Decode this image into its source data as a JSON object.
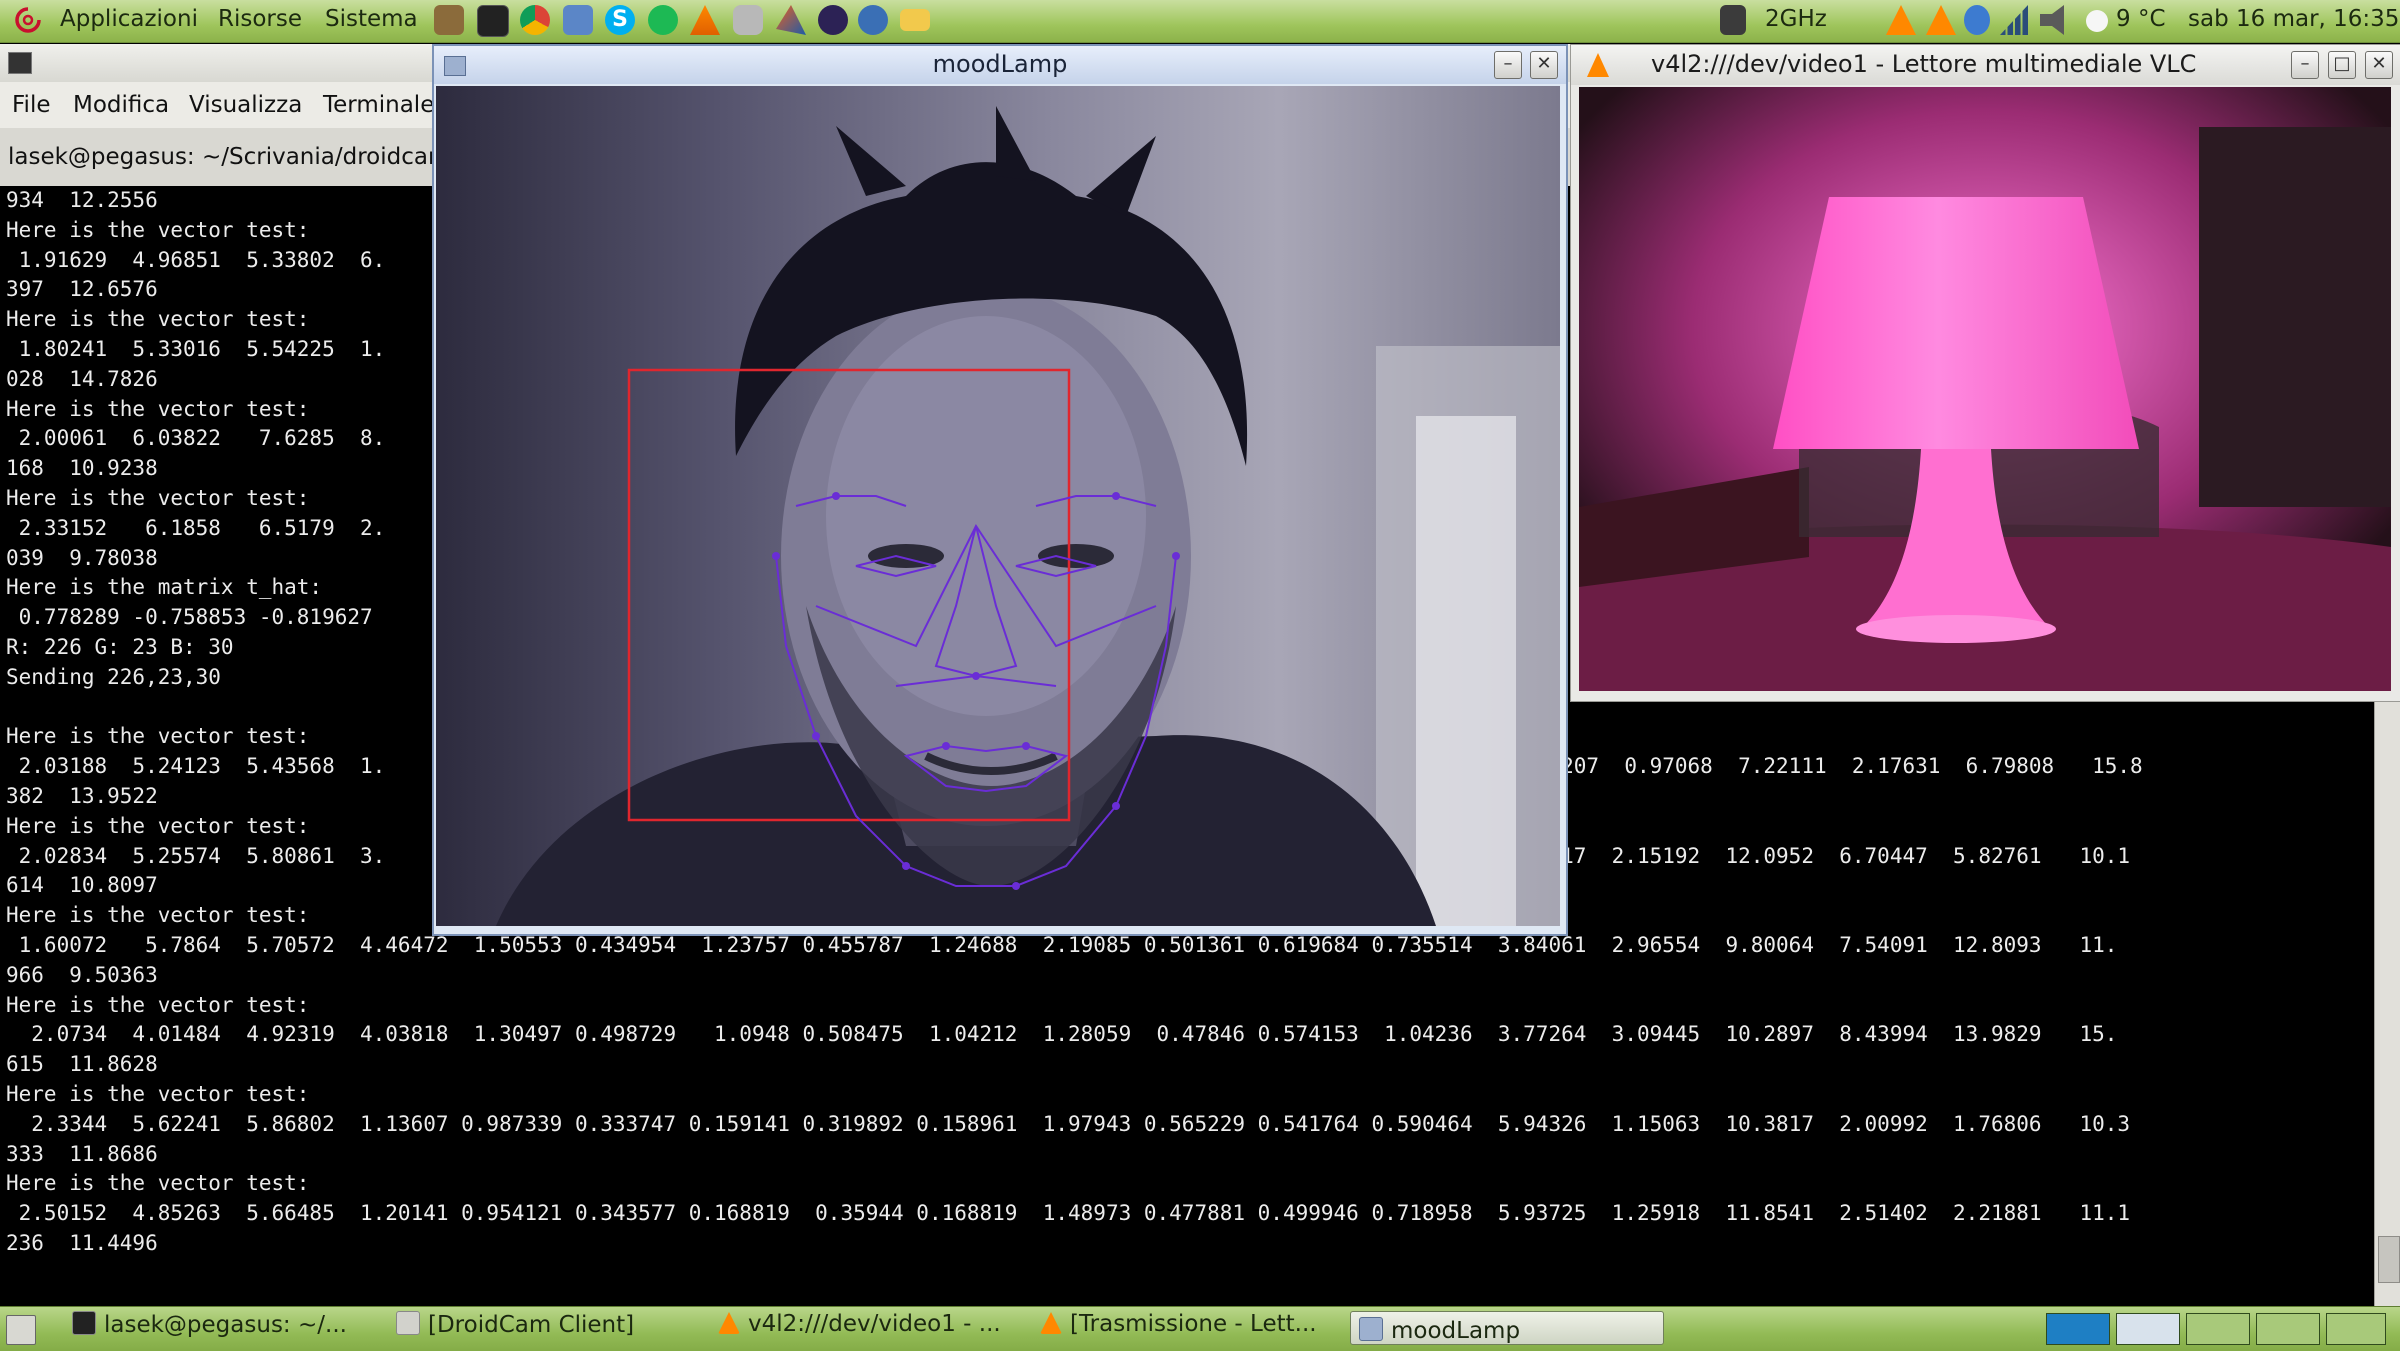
{
  "top_panel": {
    "menus": [
      "Applicazioni",
      "Risorse",
      "Sistema"
    ],
    "cpu": "2GHz",
    "weather": "9 °C",
    "clock": "sab 16 mar, 16:35"
  },
  "terminal": {
    "menu": [
      "File",
      "Modifica",
      "Visualizza",
      "Terminale"
    ],
    "tab_title": "lasek@pegasus: ~/Scrivania/droidcam",
    "lines": [
      "934  12.2556",
      "Here is the vector test:",
      " 1.91629  4.96851  5.33802  6.",
      "397  12.6576",
      "Here is the vector test:",
      " 1.80241  5.33016  5.54225  1.",
      "028  14.7826",
      "Here is the vector test:",
      " 2.00061  6.03822   7.6285  8.",
      "168  10.9238",
      "Here is the vector test:",
      " 2.33152   6.1858   6.5179  2.",
      "039  9.78038",
      "Here is the matrix t_hat:",
      " 0.778289 -0.758853 -0.819627",
      "R: 226 G: 23 B: 30",
      "Sending 226,23,30",
      "",
      "Here is the vector test:",
      " 2.03188  5.24123  5.43568  1.                                                                                 84278    3.2207  0.97068  7.22111  2.17631  6.79808   15.8",
      "382  13.9522",
      "Here is the vector test:",
      " 2.02834  5.25574  5.80861  3.                                                                                 42526  3.88217  2.15192  12.0952  6.70447  5.82761   10.1",
      "614  10.8097",
      "Here is the vector test:",
      " 1.60072   5.7864  5.70572  4.46472  1.50553 0.434954  1.23757 0.455787  1.24688  2.19085 0.501361 0.619684 0.735514  3.84061  2.96554  9.80064  7.54091  12.8093   11.",
      "966  9.50363",
      "Here is the vector test:",
      "  2.0734  4.01484  4.92319  4.03818  1.30497 0.498729   1.0948 0.508475  1.04212  1.28059  0.47846 0.574153  1.04236  3.77264  3.09445  10.2897  8.43994  13.9829   15.",
      "615  11.8628",
      "Here is the vector test:",
      "  2.3344  5.62241  5.86802  1.13607 0.987339 0.333747 0.159141 0.319892 0.158961  1.97943 0.565229 0.541764 0.590464  5.94326  1.15063  10.3817  2.00992  1.76806   10.3",
      "333  11.8686",
      "Here is the vector test:",
      " 2.50152  4.85263  5.66485  1.20141 0.954121 0.343577 0.168819  0.35944 0.168819  1.48973 0.477881 0.499946 0.718958  5.93725  1.25918  11.8541  2.51402  2.21881   11.1",
      "236  11.4496"
    ]
  },
  "moodlamp": {
    "title": "moodLamp"
  },
  "vlc": {
    "title": "v4l2:///dev/video1 - Lettore multimediale VLC",
    "lamp_color": "#ff6fd0"
  },
  "taskbar": {
    "items": [
      "lasek@pegasus: ~/...",
      "[DroidCam Client]",
      "v4l2:///dev/video1 - ...",
      "[Trasmissione - Lett...",
      "moodLamp"
    ],
    "active": "moodLamp"
  },
  "colors": {
    "panel_green": "#9fc55c",
    "face_box": "#e0262e",
    "landmarks": "#6a2dd6"
  }
}
